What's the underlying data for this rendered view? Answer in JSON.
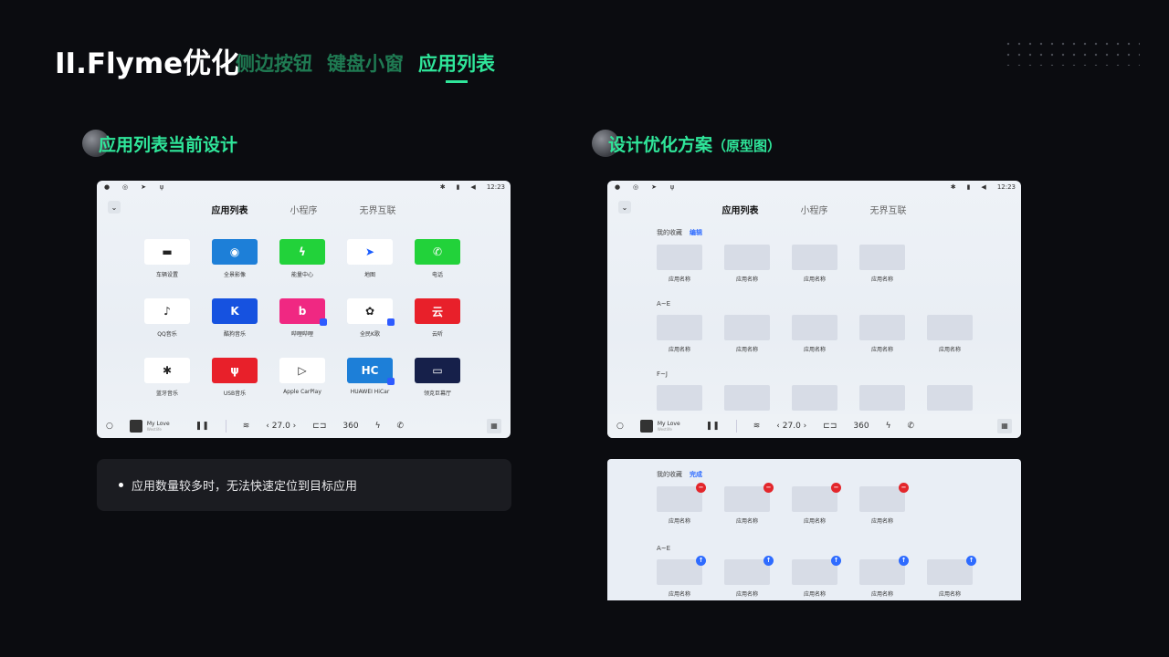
{
  "header": {
    "title": "II.Flyme优化",
    "tabs": [
      "侧边按钮",
      "键盘小窗",
      "应用列表"
    ],
    "active_tab": 2
  },
  "left_section": {
    "heading": "应用列表当前设计",
    "screen": {
      "time": "12:23",
      "tabs": [
        "应用列表",
        "小程序",
        "无界互联"
      ],
      "apps": [
        {
          "label": "车辆设置",
          "icon": "car-icon",
          "color": "#ffffff"
        },
        {
          "label": "全景影像",
          "icon": "camera-360-icon",
          "color": "#1d7fd8"
        },
        {
          "label": "能量中心",
          "icon": "lightning-icon",
          "color": "#22d23a"
        },
        {
          "label": "地图",
          "icon": "navigation-arrow-icon",
          "color": "#ffffff"
        },
        {
          "label": "电话",
          "icon": "phone-icon",
          "color": "#22d23a"
        },
        {
          "label": "QQ音乐",
          "icon": "qq-music-icon",
          "color": "#ffffff"
        },
        {
          "label": "酷狗音乐",
          "icon": "kugou-icon",
          "color": "#1652e0"
        },
        {
          "label": "哔哩哔哩",
          "icon": "bilibili-icon",
          "color": "#f02882"
        },
        {
          "label": "全民K歌",
          "icon": "k-song-icon",
          "color": "#ffffff"
        },
        {
          "label": "云听",
          "icon": "yunting-icon",
          "color": "#e8202a"
        },
        {
          "label": "蓝牙音乐",
          "icon": "bluetooth-icon",
          "color": "#ffffff"
        },
        {
          "label": "USB音乐",
          "icon": "usb-icon",
          "color": "#e8202a"
        },
        {
          "label": "Apple CarPlay",
          "icon": "carplay-icon",
          "color": "#ffffff"
        },
        {
          "label": "HUAWEI HiCar",
          "icon": "hicar-icon",
          "color": "#1d7fd8"
        },
        {
          "label": "领克巨幕厅",
          "icon": "cinema-icon",
          "color": "#16204a"
        }
      ],
      "dock": {
        "song": "My Love",
        "artist": "Westlife",
        "temp": "27.0"
      }
    },
    "note": "应用数量较多时，无法快速定位到目标应用"
  },
  "right_section": {
    "heading": "设计优化方案",
    "heading_small": "（原型图）",
    "screen_top": {
      "time": "12:23",
      "tabs": [
        "应用列表",
        "小程序",
        "无界互联"
      ],
      "favorites_label": "我的收藏",
      "edit_link": "编辑",
      "group_ae": "A~E",
      "group_fj": "F~J",
      "app_name": "应用名称",
      "dock": {
        "song": "My Love",
        "artist": "Westlife",
        "temp": "27.0"
      }
    },
    "screen_bottom": {
      "favorites_label": "我的收藏",
      "done_link": "完成",
      "group_ae": "A~E",
      "app_name": "应用名称"
    }
  }
}
